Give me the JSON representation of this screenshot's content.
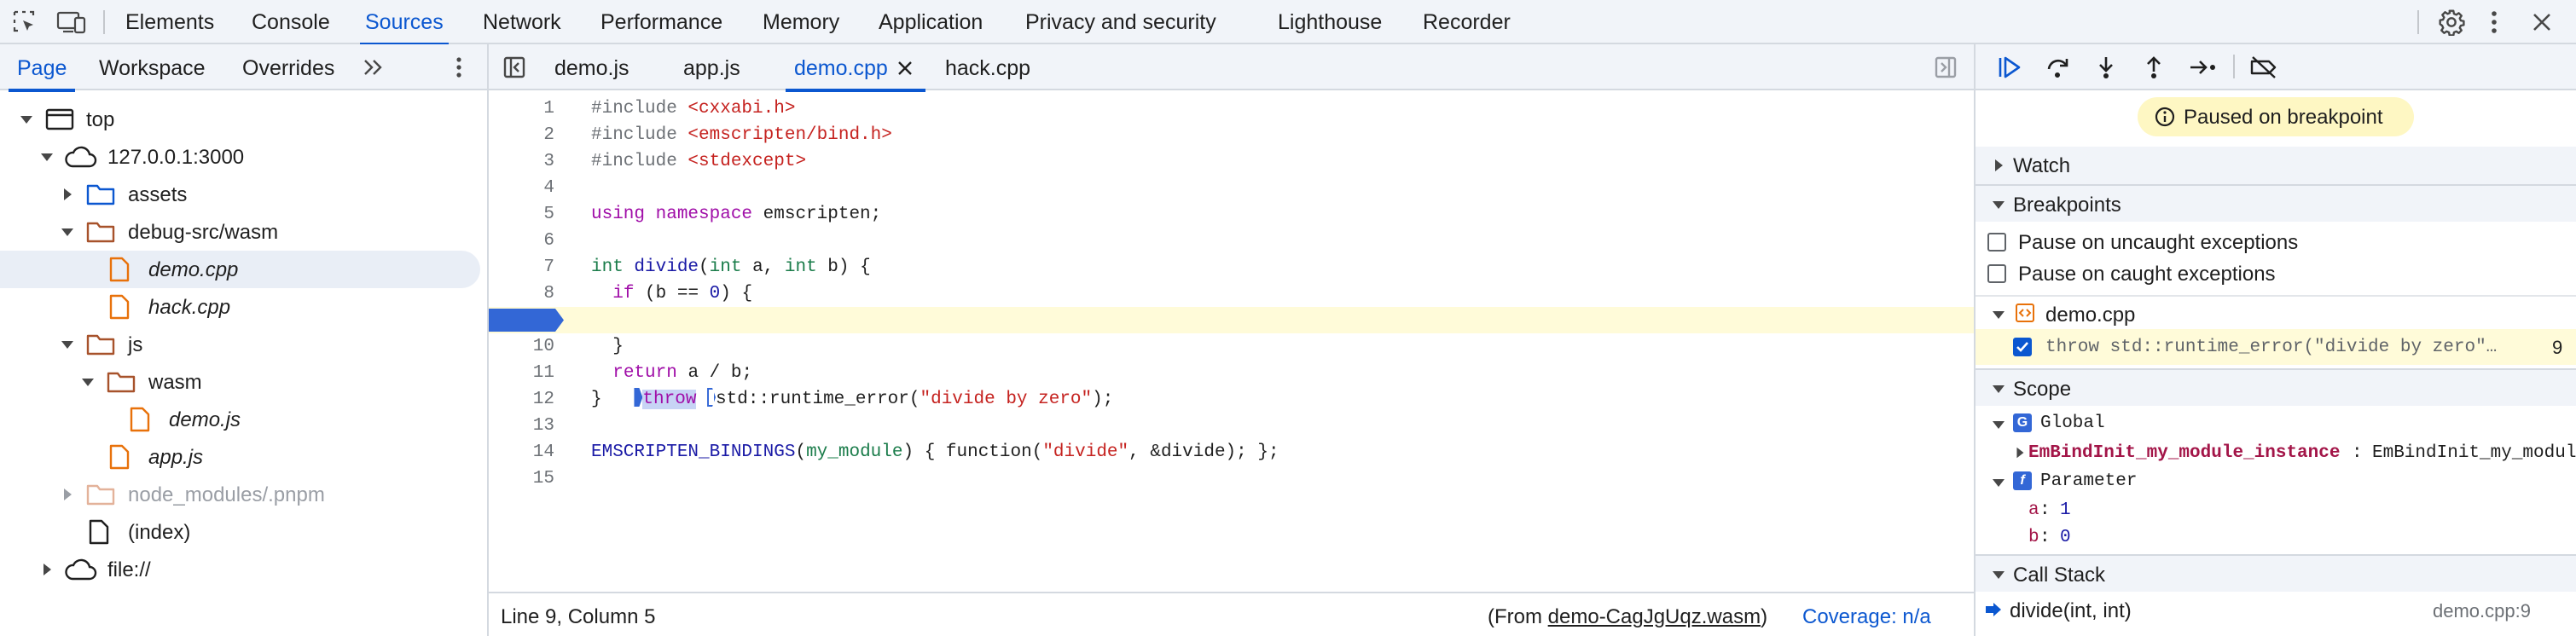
{
  "toolbar": {
    "tabs": [
      "Elements",
      "Console",
      "Sources",
      "Network",
      "Performance",
      "Memory",
      "Application",
      "Privacy and security",
      "Lighthouse",
      "Recorder"
    ],
    "active_tab": "Sources"
  },
  "navigator": {
    "tabs": [
      "Page",
      "Workspace",
      "Overrides"
    ],
    "active_tab": "Page",
    "tree": [
      {
        "label": "top"
      },
      {
        "label": "127.0.0.1:3000"
      },
      {
        "label": "assets"
      },
      {
        "label": "debug-src/wasm"
      },
      {
        "label": "demo.cpp"
      },
      {
        "label": "hack.cpp"
      },
      {
        "label": "js"
      },
      {
        "label": "wasm"
      },
      {
        "label": "demo.js"
      },
      {
        "label": "app.js"
      },
      {
        "label": "node_modules/.pnpm"
      },
      {
        "label": "(index)"
      },
      {
        "label": "file://"
      }
    ]
  },
  "editor": {
    "tabs": [
      "demo.js",
      "app.js",
      "demo.cpp",
      "hack.cpp"
    ],
    "active_tab": "demo.cpp",
    "line_numbers": [
      "1",
      "2",
      "3",
      "4",
      "5",
      "6",
      "7",
      "8",
      "9",
      "10",
      "11",
      "12",
      "13",
      "14",
      "15"
    ],
    "current_line": 9
  },
  "status": {
    "position": "Line 9, Column 5",
    "from_prefix": "(From ",
    "from_link": "demo-CagJgUqz.wasm",
    "from_suffix": ")",
    "coverage": "Coverage: n/a"
  },
  "debugger": {
    "paused_message": "Paused on breakpoint",
    "watch_title": "Watch",
    "breakpoints_title": "Breakpoints",
    "pause_uncaught": "Pause on uncaught exceptions",
    "pause_caught": "Pause on caught exceptions",
    "bp_file": "demo.cpp",
    "bp_code": "throw std::runtime_error(\"divide by zero\"…",
    "bp_line": "9",
    "scope_title": "Scope",
    "scope_global": "Global",
    "global_var_name": "EmBindInit_my_module_instance",
    "global_var_value": "EmBindInit_my_module",
    "scope_parameter": "Parameter",
    "param_a_name": "a",
    "param_a_value": "1",
    "param_b_name": "b",
    "param_b_value": "0",
    "callstack_title": "Call Stack",
    "frame_name": "divide(int, int)",
    "frame_location": "demo.cpp:9"
  },
  "colors": {
    "accent": "#0b57d0",
    "folder": "#a7522b",
    "file": "#e8710a",
    "cloud": "#1f1f1f",
    "paused_bg": "#fef7c3",
    "line_highlight": "#fffbd9"
  }
}
